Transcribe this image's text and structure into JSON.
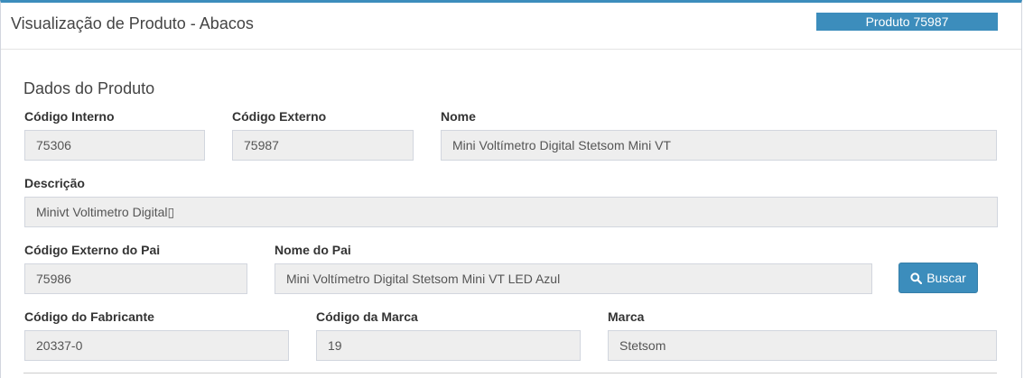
{
  "header": {
    "title": "Visualização de Produto - Abacos",
    "badge": "Produto 75987"
  },
  "section": {
    "title": "Dados do Produto"
  },
  "fields": {
    "codigo_interno": {
      "label": "Código Interno",
      "value": "75306"
    },
    "codigo_externo": {
      "label": "Código Externo",
      "value": "75987"
    },
    "nome": {
      "label": "Nome",
      "value": "Mini Voltímetro Digital Stetsom Mini VT"
    },
    "descricao": {
      "label": "Descrição",
      "value": "Minivt Voltimetro Digital▯"
    },
    "codigo_externo_pai": {
      "label": "Código Externo do Pai",
      "value": "75986"
    },
    "nome_pai": {
      "label": "Nome do Pai",
      "value": "Mini Voltímetro Digital Stetsom Mini VT LED Azul"
    },
    "codigo_fabricante": {
      "label": "Código do Fabricante",
      "value": "20337-0"
    },
    "codigo_marca": {
      "label": "Código da Marca",
      "value": "19"
    },
    "marca": {
      "label": "Marca",
      "value": "Stetsom"
    }
  },
  "buttons": {
    "buscar": {
      "label": "Buscar",
      "icon": "search-icon"
    }
  },
  "colors": {
    "primary": "#3c8dbc",
    "field_bg": "#eeeeee"
  }
}
